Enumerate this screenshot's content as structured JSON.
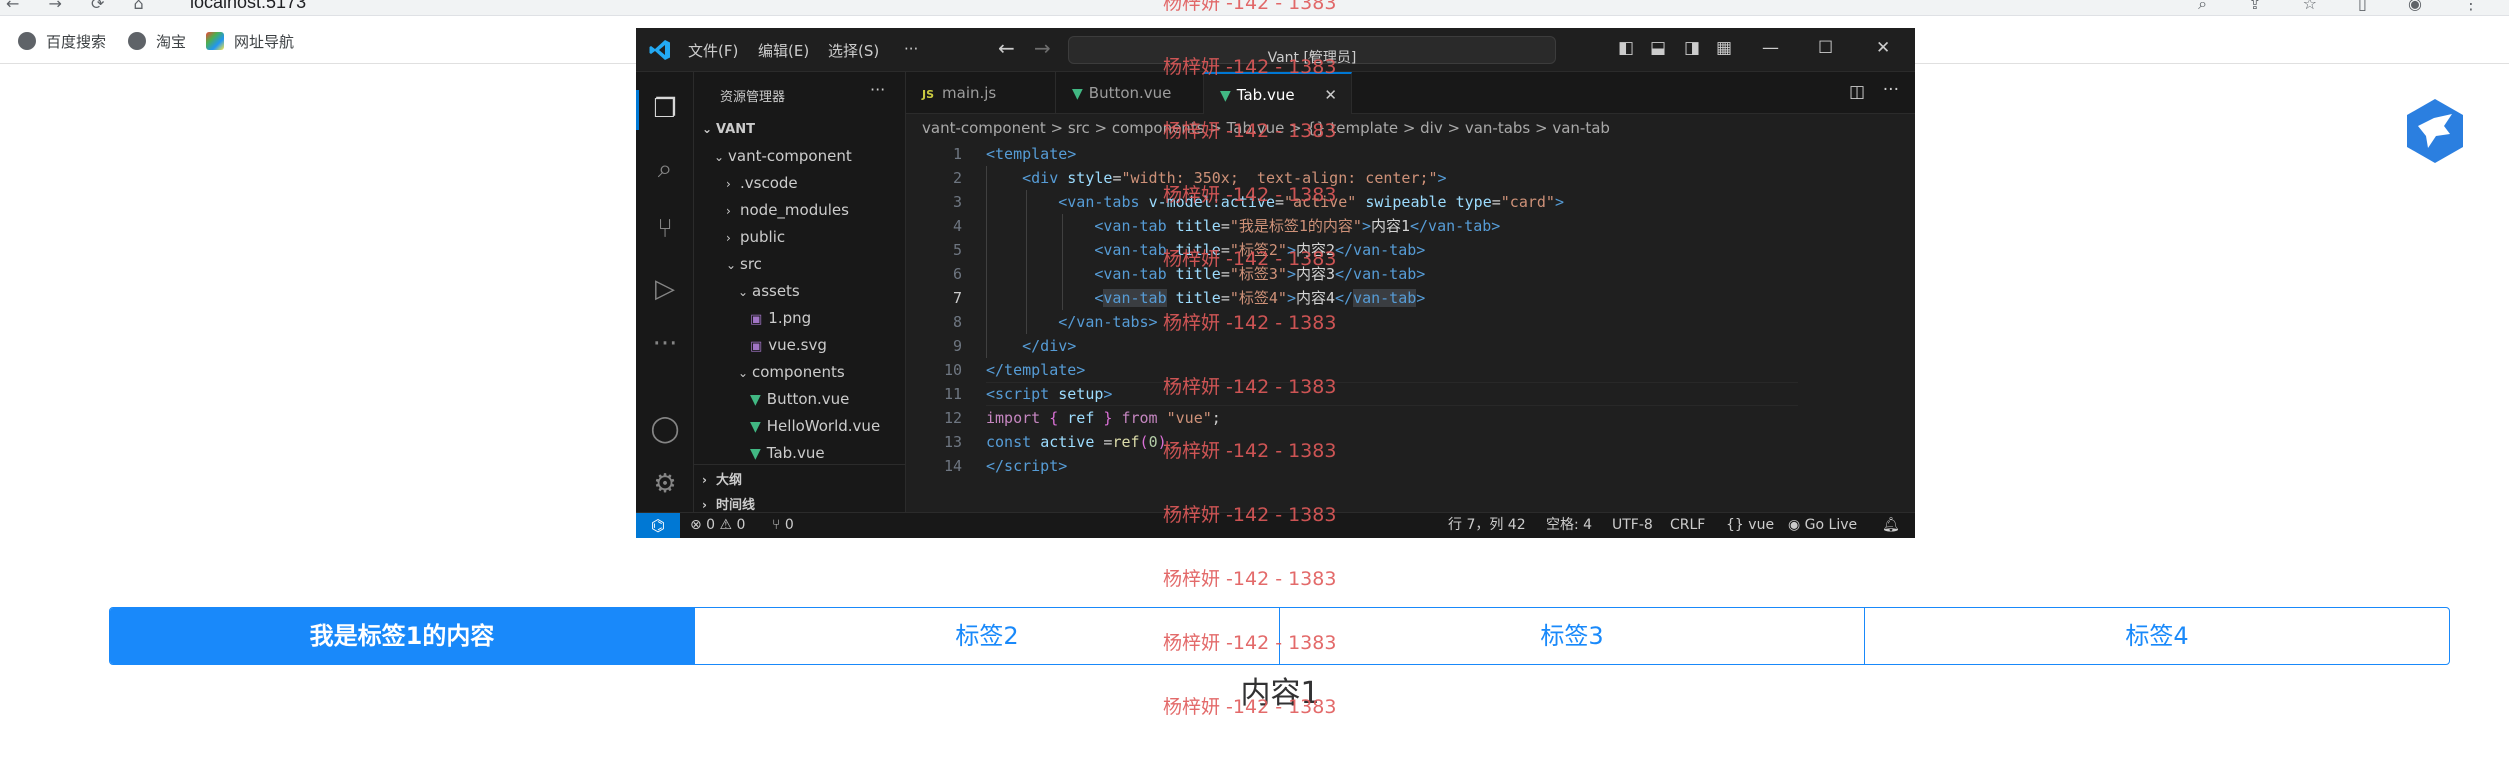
{
  "browser": {
    "url": "localhost:5173",
    "bookmarks": [
      "百度搜索",
      "淘宝",
      "网址导航"
    ]
  },
  "vscode": {
    "menus": [
      "文件(F)",
      "编辑(E)",
      "选择(S)",
      "···"
    ],
    "command_center": "Vant [管理员]",
    "sidebar_title": "资源管理器",
    "sidebar_more": "···",
    "tree": [
      {
        "label": "VANT",
        "chev": "∨",
        "indent": 0,
        "icon": "",
        "bold": true
      },
      {
        "label": "vant-component",
        "chev": "∨",
        "indent": 1,
        "icon": ""
      },
      {
        "label": ".vscode",
        "chev": ">",
        "indent": 2,
        "icon": ""
      },
      {
        "label": "node_modules",
        "chev": ">",
        "indent": 2,
        "icon": ""
      },
      {
        "label": "public",
        "chev": ">",
        "indent": 2,
        "icon": ""
      },
      {
        "label": "src",
        "chev": "∨",
        "indent": 2,
        "icon": ""
      },
      {
        "label": "assets",
        "chev": "∨",
        "indent": 3,
        "icon": ""
      },
      {
        "label": "1.png",
        "chev": "",
        "indent": 4,
        "icon": "img"
      },
      {
        "label": "vue.svg",
        "chev": "",
        "indent": 4,
        "icon": "img"
      },
      {
        "label": "components",
        "chev": "∨",
        "indent": 3,
        "icon": ""
      },
      {
        "label": "Button.vue",
        "chev": "",
        "indent": 4,
        "icon": "vue"
      },
      {
        "label": "HelloWorld.vue",
        "chev": "",
        "indent": 4,
        "icon": "vue"
      },
      {
        "label": "Tab.vue",
        "chev": "",
        "indent": 4,
        "icon": "vue"
      }
    ],
    "outline": "大纲",
    "timeline": "时间线",
    "tabs": [
      {
        "label": "main.js",
        "icon": "JS"
      },
      {
        "label": "Button.vue",
        "icon": "vue"
      },
      {
        "label": "Tab.vue",
        "icon": "vue",
        "close": "✕"
      }
    ],
    "breadcrumb": "vant-component  >  src  >  components  >  Tab.vue  >  {} template  >  div  >  van-tabs  >  van-tab",
    "line_numbers": [
      "1",
      "2",
      "3",
      "4",
      "5",
      "6",
      "7",
      "8",
      "9",
      "10",
      "11",
      "12",
      "13",
      "14"
    ],
    "current_line": "7",
    "status": {
      "errors": "⊗ 0",
      "warnings": "⚠ 0",
      "ports": "⑂ 0",
      "position": "行 7，列 42",
      "indent": "空格: 4",
      "encoding": "UTF-8",
      "eol": "CRLF",
      "language": "vue",
      "golive": "Go Live"
    }
  },
  "page": {
    "tabs": [
      "我是标签1的内容",
      "标签2",
      "标签3",
      "标签4"
    ],
    "active_tab": 0,
    "panel_text": "内容1"
  },
  "watermark": "杨梓妍 -142 - 1383",
  "colors": {
    "vant_blue": "#1989fa",
    "vscode_bg": "#1e1e1e",
    "accent": "#0078d4",
    "watermark": "#e05a5a"
  }
}
